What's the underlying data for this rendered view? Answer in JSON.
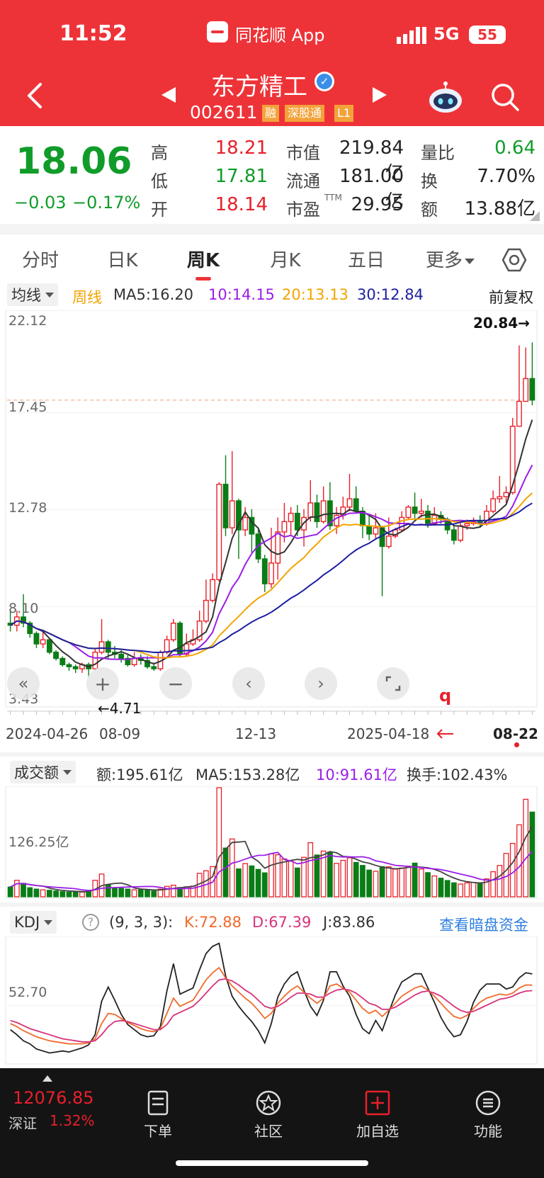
{
  "status_bar": {
    "time": "11:52",
    "app_label": "同花顺 App",
    "network": "5G",
    "battery": "55"
  },
  "stock": {
    "name": "东方精工",
    "code": "002611",
    "tags": [
      "融",
      "深股通",
      "L1"
    ]
  },
  "quote": {
    "price": "18.06",
    "change": "−0.03",
    "change_pct": "−0.17%",
    "high_label": "高",
    "high": "18.21",
    "low_label": "低",
    "low": "17.81",
    "open_label": "开",
    "open": "18.14",
    "mcap_label": "市值",
    "mcap": "219.84亿",
    "float_label": "流通",
    "float": "181.00亿",
    "pe_label": "市盈",
    "pe_sup": "TTM",
    "pe": "29.95",
    "vr_label": "量比",
    "vr": "0.64",
    "turn_label": "换",
    "turn": "7.70%",
    "amt_label": "额",
    "amt": "13.88亿"
  },
  "tabs": [
    "分时",
    "日K",
    "周K",
    "月K",
    "五日",
    "更多"
  ],
  "active_tab": "周K",
  "kline": {
    "indicator_select": "均线",
    "period_label": "周线",
    "ma5": "MA5:16.20",
    "ma10": "10:14.15",
    "ma20": "20:13.13",
    "ma30": "30:12.84",
    "adjust": "前复权",
    "y_labels": [
      "22.12",
      "17.45",
      "12.78",
      "8.10",
      "3.43"
    ],
    "max_mark": "20.84→",
    "min_mark": "←4.71",
    "q_marker": "q",
    "x_labels": [
      "2024-04-26",
      "08-09",
      "12-13",
      "2025-04-18",
      "08-22"
    ]
  },
  "volume": {
    "indicator_select": "成交额",
    "amount": "额:195.61亿",
    "ma5": "MA5:153.28亿",
    "ma10": "10:91.61亿",
    "turnover": "换手:102.43%",
    "y_label": "126.25亿"
  },
  "kdj": {
    "indicator_select": "KDJ",
    "params": "(9, 3, 3):",
    "k": "K:72.88",
    "d": "D:67.39",
    "j": "J:83.86",
    "link": "查看暗盘资金",
    "y_label": "52.70"
  },
  "bottom_bar": {
    "index_value": "12076.85",
    "index_name": "深证",
    "index_pct": "1.32%",
    "items": [
      "下单",
      "社区",
      "加自选",
      "功能"
    ]
  },
  "colors": {
    "header_red": "#ee3338",
    "up": "#e8202a",
    "down": "#0a7d16",
    "ma5": "#333333",
    "ma10": "#9b1ee8",
    "ma20": "#f2a400",
    "ma30": "#1d1fa0",
    "link_blue": "#2f7fe0"
  },
  "chart_data": {
    "type": "candlestick",
    "y_range": [
      3.43,
      22.12
    ],
    "candles": [
      [
        7.3,
        7.2,
        7.9,
        6.9
      ],
      [
        7.2,
        7.6,
        7.9,
        6.9
      ],
      [
        7.6,
        7.3,
        8.7,
        7.1
      ],
      [
        7.3,
        6.8,
        7.4,
        6.6
      ],
      [
        6.8,
        6.3,
        6.9,
        6.1
      ],
      [
        6.3,
        6.5,
        6.9,
        6.1
      ],
      [
        6.5,
        5.9,
        6.6,
        5.8
      ],
      [
        5.9,
        5.6,
        6.0,
        5.5
      ],
      [
        5.6,
        5.3,
        5.7,
        5.2
      ],
      [
        5.3,
        5.2,
        5.4,
        5.0
      ],
      [
        5.2,
        5.1,
        5.3,
        4.9
      ],
      [
        5.1,
        5.3,
        5.4,
        4.9
      ],
      [
        5.3,
        5.1,
        5.4,
        4.7
      ],
      [
        5.1,
        5.9,
        6.1,
        5.0
      ],
      [
        5.9,
        6.4,
        7.5,
        5.8
      ],
      [
        6.4,
        5.9,
        6.5,
        5.6
      ],
      [
        5.9,
        5.8,
        6.2,
        5.6
      ],
      [
        5.8,
        5.6,
        6.0,
        5.4
      ],
      [
        5.6,
        5.3,
        5.8,
        5.2
      ],
      [
        5.3,
        5.6,
        5.9,
        5.2
      ],
      [
        5.6,
        5.5,
        5.8,
        5.3
      ],
      [
        5.5,
        5.2,
        5.7,
        5.1
      ],
      [
        5.2,
        5.1,
        5.4,
        5.0
      ],
      [
        5.1,
        5.9,
        6.0,
        5.0
      ],
      [
        5.9,
        6.5,
        6.7,
        5.8
      ],
      [
        6.5,
        7.3,
        7.5,
        6.4
      ],
      [
        7.3,
        5.8,
        7.4,
        5.7
      ],
      [
        5.8,
        6.3,
        6.8,
        5.7
      ],
      [
        6.3,
        6.5,
        7.0,
        6.2
      ],
      [
        6.5,
        7.4,
        7.9,
        6.4
      ],
      [
        7.4,
        8.4,
        9.4,
        7.3
      ],
      [
        8.4,
        9.4,
        9.7,
        8.3
      ],
      [
        9.4,
        14.0,
        14.1,
        9.3
      ],
      [
        14.0,
        11.9,
        15.4,
        11.5
      ],
      [
        11.9,
        13.2,
        15.6,
        11.6
      ],
      [
        13.2,
        11.8,
        13.3,
        10.4
      ],
      [
        11.8,
        12.4,
        12.9,
        11.5
      ],
      [
        12.4,
        11.6,
        12.8,
        10.7
      ],
      [
        11.6,
        10.4,
        11.8,
        10.2
      ],
      [
        10.4,
        9.2,
        10.6,
        8.8
      ],
      [
        9.2,
        10.2,
        11.9,
        9.0
      ],
      [
        10.2,
        11.7,
        12.4,
        9.4
      ],
      [
        11.7,
        12.2,
        13.1,
        11.2
      ],
      [
        12.2,
        12.6,
        12.9,
        11.5
      ],
      [
        12.6,
        11.8,
        13.0,
        11.5
      ],
      [
        11.8,
        12.4,
        12.8,
        11.0
      ],
      [
        12.4,
        13.1,
        14.2,
        12.2
      ],
      [
        13.1,
        12.2,
        13.5,
        11.9
      ],
      [
        12.2,
        13.2,
        13.9,
        12.1
      ],
      [
        13.2,
        12.0,
        14.1,
        11.8
      ],
      [
        12.0,
        12.5,
        12.9,
        11.6
      ],
      [
        12.5,
        12.9,
        13.4,
        12.3
      ],
      [
        12.9,
        13.3,
        14.5,
        12.7
      ],
      [
        13.3,
        12.7,
        13.9,
        12.6
      ],
      [
        12.7,
        12.0,
        12.9,
        11.4
      ],
      [
        12.0,
        11.6,
        12.5,
        11.3
      ],
      [
        11.6,
        11.9,
        12.6,
        11.4
      ],
      [
        11.9,
        11.0,
        12.0,
        8.6
      ],
      [
        11.0,
        11.5,
        12.4,
        10.9
      ],
      [
        11.5,
        11.8,
        11.9,
        11.4
      ],
      [
        11.8,
        12.4,
        12.7,
        11.7
      ],
      [
        12.4,
        12.9,
        13.0,
        12.3
      ],
      [
        12.9,
        12.6,
        13.6,
        12.3
      ],
      [
        12.6,
        12.7,
        13.3,
        12.4
      ],
      [
        12.7,
        12.1,
        13.0,
        11.9
      ],
      [
        12.1,
        12.5,
        12.9,
        12.0
      ],
      [
        12.5,
        12.3,
        12.7,
        12.1
      ],
      [
        12.3,
        11.8,
        12.4,
        11.6
      ],
      [
        11.8,
        11.3,
        12.0,
        11.1
      ],
      [
        11.3,
        12.0,
        12.2,
        11.2
      ],
      [
        12.0,
        12.1,
        12.3,
        11.8
      ],
      [
        12.1,
        12.2,
        12.4,
        12.0
      ],
      [
        12.2,
        12.1,
        12.5,
        11.9
      ],
      [
        12.1,
        12.7,
        13.0,
        12.0
      ],
      [
        12.7,
        13.3,
        13.7,
        12.6
      ],
      [
        13.3,
        13.4,
        14.4,
        13.1
      ],
      [
        13.4,
        13.6,
        13.9,
        13.1
      ],
      [
        13.6,
        16.8,
        17.2,
        13.5
      ],
      [
        16.8,
        18.0,
        20.7,
        17.4
      ],
      [
        18.0,
        19.1,
        20.6,
        18.3
      ],
      [
        19.1,
        18.06,
        20.84,
        17.81
      ]
    ],
    "volume": [
      0.42,
      0.71,
      0.58,
      0.39,
      0.33,
      0.3,
      0.28,
      0.25,
      0.22,
      0.2,
      0.23,
      0.2,
      0.28,
      0.71,
      0.98,
      0.52,
      0.39,
      0.36,
      0.33,
      0.3,
      0.3,
      0.28,
      0.25,
      0.33,
      0.45,
      0.5,
      0.4,
      0.43,
      0.46,
      1.01,
      1.12,
      1.3,
      4.7,
      2.1,
      2.49,
      1.2,
      1.43,
      1.33,
      1.18,
      1.03,
      1.85,
      1.81,
      1.63,
      1.53,
      1.24,
      1.7,
      2.33,
      1.8,
      1.97,
      1.93,
      1.44,
      1.57,
      1.68,
      1.48,
      1.35,
      1.15,
      1.1,
      1.3,
      1.29,
      1.19,
      1.24,
      1.32,
      1.45,
      1.2,
      1.04,
      0.9,
      0.8,
      0.7,
      0.6,
      0.55,
      0.6,
      0.62,
      0.6,
      0.77,
      1.08,
      1.35,
      1.87,
      2.3,
      3.1,
      4.2,
      3.65
    ],
    "kdj": {
      "y_label_value": 52.7,
      "K": [
        35,
        32,
        28,
        25,
        22,
        20,
        18,
        17,
        16,
        15,
        15,
        15,
        16,
        20,
        35,
        45,
        44,
        40,
        36,
        33,
        30,
        28,
        27,
        30,
        45,
        60,
        52,
        55,
        58,
        68,
        78,
        85,
        90,
        80,
        72,
        66,
        60,
        55,
        48,
        40,
        45,
        55,
        62,
        68,
        72,
        66,
        60,
        55,
        60,
        72,
        74,
        70,
        66,
        58,
        50,
        45,
        48,
        42,
        48,
        55,
        62,
        66,
        70,
        72,
        68,
        62,
        55,
        48,
        42,
        40,
        43,
        50,
        56,
        60,
        62,
        64,
        63,
        65,
        70,
        73,
        72.88
      ],
      "D": [
        38,
        36,
        33,
        30,
        28,
        26,
        24,
        22,
        20,
        19,
        18,
        17,
        17,
        18,
        24,
        32,
        37,
        38,
        37,
        35,
        33,
        31,
        29,
        29,
        34,
        43,
        46,
        49,
        52,
        58,
        65,
        72,
        78,
        79,
        77,
        73,
        68,
        64,
        58,
        52,
        50,
        52,
        56,
        61,
        65,
        65,
        64,
        61,
        61,
        65,
        68,
        69,
        68,
        65,
        60,
        55,
        53,
        49,
        49,
        51,
        55,
        59,
        63,
        66,
        67,
        65,
        62,
        57,
        52,
        48,
        46,
        47,
        50,
        53,
        56,
        59,
        60,
        62,
        65,
        67,
        67.39
      ],
      "J": [
        29,
        24,
        18,
        15,
        10,
        8,
        6,
        7,
        8,
        7,
        9,
        11,
        14,
        24,
        57,
        71,
        58,
        44,
        34,
        29,
        24,
        22,
        23,
        32,
        67,
        94,
        64,
        67,
        70,
        88,
        104,
        111,
        114,
        82,
        62,
        52,
        44,
        37,
        28,
        16,
        35,
        61,
        74,
        82,
        86,
        68,
        52,
        43,
        58,
        86,
        86,
        72,
        62,
        44,
        30,
        25,
        38,
        28,
        46,
        63,
        76,
        80,
        84,
        84,
        70,
        56,
        41,
        30,
        22,
        24,
        37,
        56,
        68,
        74,
        74,
        74,
        69,
        71,
        80,
        85,
        83.86
      ]
    }
  }
}
